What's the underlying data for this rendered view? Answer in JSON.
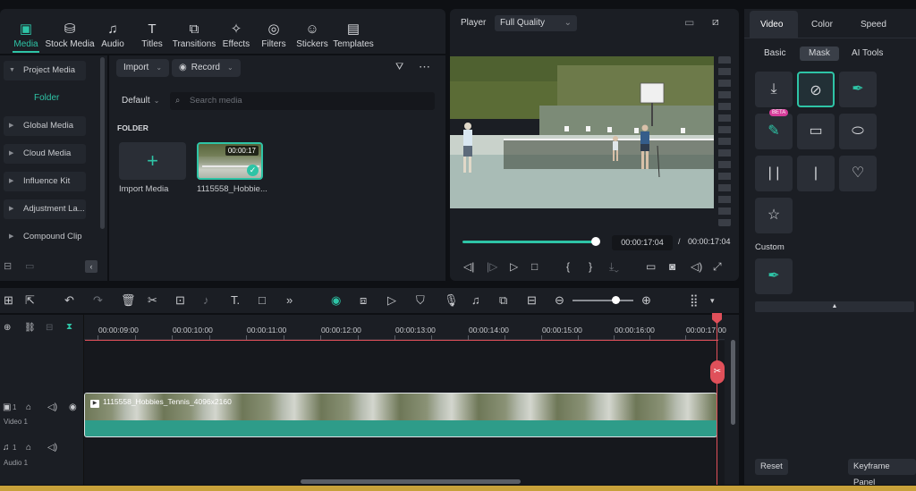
{
  "toolbar": {
    "tabs": [
      {
        "label": "Media",
        "icon": "media-icon",
        "active": true
      },
      {
        "label": "Stock Media",
        "icon": "stock-media-icon"
      },
      {
        "label": "Audio",
        "icon": "music-note-icon"
      },
      {
        "label": "Titles",
        "icon": "text-t-icon"
      },
      {
        "label": "Transitions",
        "icon": "transitions-icon"
      },
      {
        "label": "Effects",
        "icon": "effects-icon"
      },
      {
        "label": "Filters",
        "icon": "filters-icon"
      },
      {
        "label": "Stickers",
        "icon": "stickers-icon"
      },
      {
        "label": "Templates",
        "icon": "templates-icon"
      }
    ]
  },
  "left_nav": {
    "items": [
      "Project Media",
      "Global Media",
      "Cloud Media",
      "Influence Kit",
      "Adjustment La...",
      "Compound Clip"
    ],
    "folder": "Folder"
  },
  "media": {
    "import_label": "Import",
    "record_label": "Record",
    "sort_label": "Default",
    "search_placeholder": "Search media",
    "folder_heading": "FOLDER",
    "import_tile_label": "Import Media",
    "clip_name": "1115558_Hobbie...",
    "clip_duration": "00:00:17"
  },
  "player": {
    "label": "Player",
    "quality": "Full Quality",
    "current_time": "00:00:17:04",
    "separator": "/",
    "total_time": "00:00:17:04",
    "progress": 1.0
  },
  "props": {
    "tabs": [
      "Video",
      "Color",
      "Speed"
    ],
    "active_tab": "Video",
    "subtabs": [
      "Basic",
      "Mask",
      "AI Tools"
    ],
    "active_subtab": "Mask",
    "beta_badge": "BETA",
    "custom_label": "Custom",
    "reset_label": "Reset",
    "keyframe_label": "Keyframe Panel"
  },
  "timeline": {
    "ruler_labels": [
      "00:00:09:00",
      "00:00:10:00",
      "00:00:11:00",
      "00:00:12:00",
      "00:00:13:00",
      "00:00:14:00",
      "00:00:15:00",
      "00:00:16:00",
      "00:00:17:00"
    ],
    "video_track_label": "Video 1",
    "audio_track_label": "Audio 1",
    "video_track_num": "1",
    "audio_track_num": "1",
    "clip_title": "1115558_Hobbies_Tennis_4096x2160"
  },
  "colors": {
    "accent": "#2ec4a6",
    "playhead": "#e0505a",
    "panel": "#1b1e24"
  }
}
